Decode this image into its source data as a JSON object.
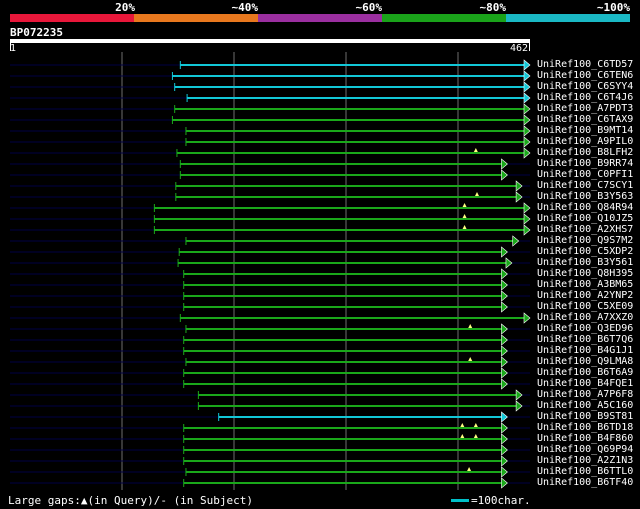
{
  "legend": {
    "labels": [
      "20%",
      "~40%",
      "~60%",
      "~80%",
      "~100%"
    ],
    "colors": [
      "#e8173a",
      "#e8781e",
      "#9b2fa0",
      "#1aa31a",
      "#1ab8c4"
    ]
  },
  "query": {
    "name": "BP072235",
    "start": "1",
    "end": "462",
    "length": 462
  },
  "colors": {
    "cyan": "#12c8d8",
    "green": "#1aa81a",
    "track": "#000044",
    "grid": "#6e6e6e",
    "gap": "#ffff80"
  },
  "hits": [
    {
      "name": "UniRef100_C6TD57",
      "start": 152,
      "end": 462,
      "color": "cyan",
      "gaps": []
    },
    {
      "name": "UniRef100_C6TEN6",
      "start": 145,
      "end": 462,
      "color": "cyan",
      "gaps": []
    },
    {
      "name": "UniRef100_C6SYY4",
      "start": 147,
      "end": 462,
      "color": "cyan",
      "gaps": []
    },
    {
      "name": "UniRef100_C6T4J6",
      "start": 158,
      "end": 462,
      "color": "cyan",
      "gaps": []
    },
    {
      "name": "UniRef100_A7PDT3",
      "start": 147,
      "end": 462,
      "color": "green",
      "gaps": []
    },
    {
      "name": "UniRef100_C6TAX9",
      "start": 145,
      "end": 462,
      "color": "green",
      "gaps": []
    },
    {
      "name": "UniRef100_B9MT14",
      "start": 157,
      "end": 462,
      "color": "green",
      "gaps": []
    },
    {
      "name": "UniRef100_A9PIL0",
      "start": 157,
      "end": 462,
      "color": "green",
      "gaps": []
    },
    {
      "name": "UniRef100_B8LFH2",
      "start": 149,
      "end": 462,
      "color": "green",
      "gaps": [
        414
      ]
    },
    {
      "name": "UniRef100_B9RR74",
      "start": 152,
      "end": 442,
      "color": "green",
      "gaps": []
    },
    {
      "name": "UniRef100_C0PFI1",
      "start": 152,
      "end": 442,
      "color": "green",
      "gaps": []
    },
    {
      "name": "UniRef100_C7SCY1",
      "start": 148,
      "end": 455,
      "color": "green",
      "gaps": []
    },
    {
      "name": "UniRef100_B3Y563",
      "start": 148,
      "end": 455,
      "color": "green",
      "gaps": [
        415
      ]
    },
    {
      "name": "UniRef100_Q84R94",
      "start": 129,
      "end": 462,
      "color": "green",
      "gaps": [
        404
      ]
    },
    {
      "name": "UniRef100_Q10JZ5",
      "start": 129,
      "end": 462,
      "color": "green",
      "gaps": [
        404
      ]
    },
    {
      "name": "UniRef100_A2XHS7",
      "start": 129,
      "end": 462,
      "color": "green",
      "gaps": [
        404
      ]
    },
    {
      "name": "UniRef100_Q9S7M2",
      "start": 157,
      "end": 452,
      "color": "green",
      "gaps": []
    },
    {
      "name": "UniRef100_C5XDP2",
      "start": 151,
      "end": 442,
      "color": "green",
      "gaps": []
    },
    {
      "name": "UniRef100_B3Y561",
      "start": 150,
      "end": 446,
      "color": "green",
      "gaps": []
    },
    {
      "name": "UniRef100_Q8H395",
      "start": 155,
      "end": 442,
      "color": "green",
      "gaps": []
    },
    {
      "name": "UniRef100_A3BM65",
      "start": 155,
      "end": 442,
      "color": "green",
      "gaps": []
    },
    {
      "name": "UniRef100_A2YNP2",
      "start": 155,
      "end": 442,
      "color": "green",
      "gaps": []
    },
    {
      "name": "UniRef100_C5XE09",
      "start": 155,
      "end": 442,
      "color": "green",
      "gaps": []
    },
    {
      "name": "UniRef100_A7XXZ0",
      "start": 152,
      "end": 462,
      "color": "green",
      "gaps": []
    },
    {
      "name": "UniRef100_Q3ED96",
      "start": 157,
      "end": 442,
      "color": "green",
      "gaps": [
        409
      ]
    },
    {
      "name": "UniRef100_B6T7Q6",
      "start": 155,
      "end": 442,
      "color": "green",
      "gaps": []
    },
    {
      "name": "UniRef100_B4G1J1",
      "start": 155,
      "end": 442,
      "color": "green",
      "gaps": []
    },
    {
      "name": "UniRef100_Q9LMA8",
      "start": 157,
      "end": 442,
      "color": "green",
      "gaps": [
        409
      ]
    },
    {
      "name": "UniRef100_B6T6A9",
      "start": 155,
      "end": 442,
      "color": "green",
      "gaps": []
    },
    {
      "name": "UniRef100_B4FQE1",
      "start": 155,
      "end": 442,
      "color": "green",
      "gaps": []
    },
    {
      "name": "UniRef100_A7P6F8",
      "start": 168,
      "end": 455,
      "color": "green",
      "gaps": []
    },
    {
      "name": "UniRef100_A5C160",
      "start": 168,
      "end": 455,
      "color": "green",
      "gaps": []
    },
    {
      "name": "UniRef100_B9ST81",
      "start": 186,
      "end": 442,
      "color": "cyan",
      "gaps": []
    },
    {
      "name": "UniRef100_B6TD18",
      "start": 155,
      "end": 442,
      "color": "green",
      "gaps": [
        402,
        414
      ]
    },
    {
      "name": "UniRef100_B4F860",
      "start": 155,
      "end": 442,
      "color": "green",
      "gaps": [
        402,
        414
      ]
    },
    {
      "name": "UniRef100_Q69P94",
      "start": 155,
      "end": 442,
      "color": "green",
      "gaps": []
    },
    {
      "name": "UniRef100_A2Z1N3",
      "start": 155,
      "end": 442,
      "color": "green",
      "gaps": []
    },
    {
      "name": "UniRef100_B6TTL0",
      "start": 157,
      "end": 442,
      "color": "green",
      "gaps": [
        408
      ]
    },
    {
      "name": "UniRef100_B6TF40",
      "start": 155,
      "end": 442,
      "color": "green",
      "gaps": []
    }
  ],
  "footer": {
    "gaps_text": "Large gaps:▲(in Query)/- (in Subject)",
    "key_text": "=100char."
  }
}
